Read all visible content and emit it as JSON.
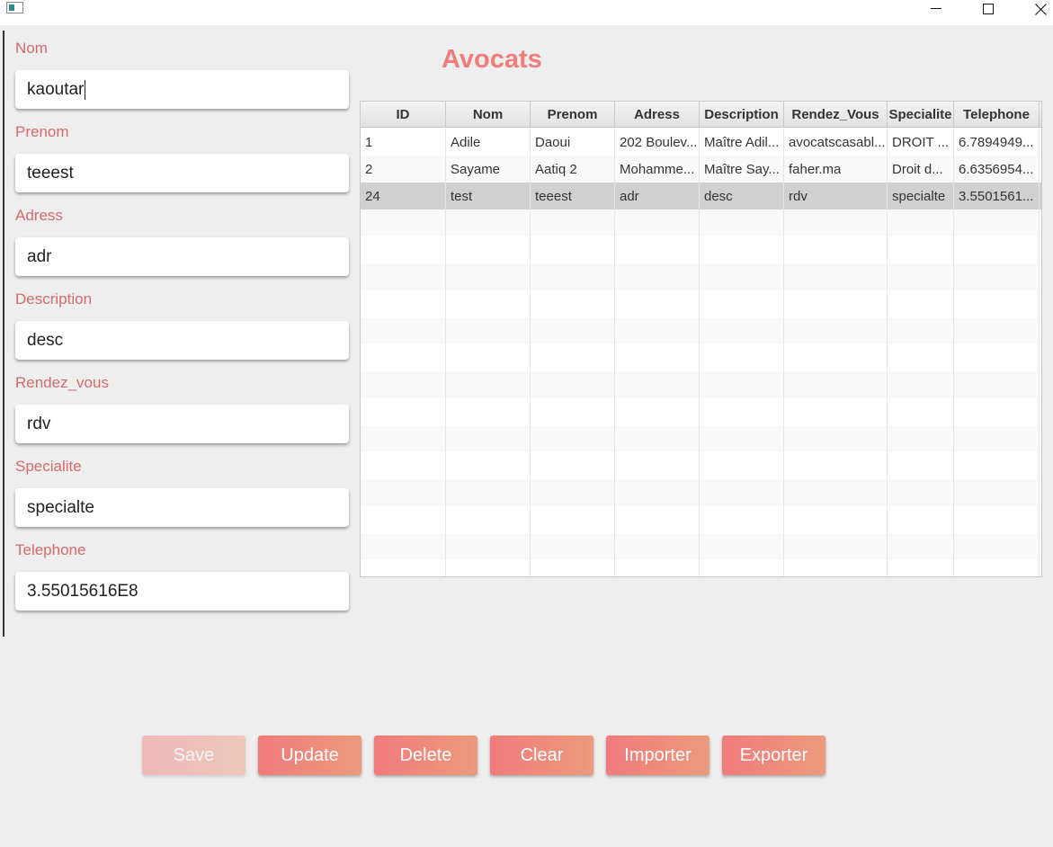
{
  "window": {
    "icon": "app-window-icon",
    "controls": [
      "minimize-icon",
      "maximize-icon",
      "close-icon"
    ]
  },
  "form": {
    "fields": [
      {
        "label": "Nom",
        "value": "kaoutar"
      },
      {
        "label": "Prenom",
        "value": "teeest"
      },
      {
        "label": "Adress",
        "value": "adr"
      },
      {
        "label": "Description",
        "value": "desc"
      },
      {
        "label": "Rendez_vous",
        "value": "rdv"
      },
      {
        "label": "Specialite",
        "value": "specialte"
      },
      {
        "label": "Telephone",
        "value": "3.55015616E8"
      }
    ]
  },
  "title": "Avocats",
  "table": {
    "columns": [
      "ID",
      "Nom",
      "Prenom",
      "Adress",
      "Description",
      "Rendez_Vous",
      "Specialite",
      "Telephone"
    ],
    "rows": [
      [
        "1",
        "Adile",
        "Daoui",
        "202 Boulev...",
        "Maître Adil...",
        "avocatscasabl...",
        "DROIT ...",
        "6.7894949..."
      ],
      [
        "2",
        "Sayame",
        "Aatiq 2",
        "Mohamme...",
        "Maître Say...",
        "faher.ma",
        "Droit d...",
        "6.6356954..."
      ],
      [
        "24",
        "test",
        "teeest",
        "adr",
        "desc",
        "rdv",
        "specialte",
        "3.5501561..."
      ]
    ],
    "selected_row": 2
  },
  "buttons": {
    "save": "Save",
    "update": "Update",
    "delete": "Delete",
    "clear": "Clear",
    "importer": "Importer",
    "exporter": "Exporter"
  },
  "colors": {
    "label": "#d46a6a",
    "title": "#f07c7c",
    "button_start": "#f07b7b",
    "button_end": "#ec9a7d"
  }
}
